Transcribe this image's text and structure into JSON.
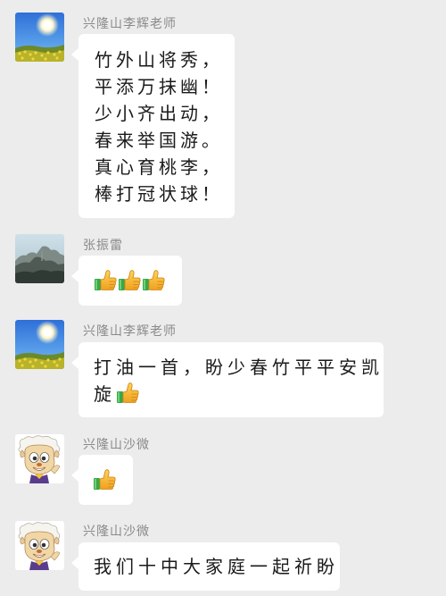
{
  "messages": [
    {
      "sender": "兴隆山李辉老师",
      "avatar": "sky-sunflower-avatar",
      "lines": [
        "竹外山将秀，",
        "平添万抹幽！",
        "少小齐出动，",
        "春来举国游。",
        "真心育桃李，",
        "棒打冠状球！"
      ]
    },
    {
      "sender": "张振雷",
      "avatar": "mountain-avatar",
      "emoji": "thumbs-up-icon"
    },
    {
      "sender": "兴隆山李辉老师",
      "avatar": "sky-sunflower-avatar",
      "text_line1": "打油一首，盼少春竹平平安凯",
      "text_line2": "旋"
    },
    {
      "sender": "兴隆山沙微",
      "avatar": "cartoon-sheep-avatar",
      "emoji": "thumbs-up-icon"
    },
    {
      "sender": "兴隆山沙微",
      "avatar": "cartoon-sheep-avatar",
      "text": "我们十中大家庭一起祈盼"
    }
  ],
  "colors": {
    "background": "#ececec",
    "bubble": "#ffffff",
    "sender_name": "#8a8a8a",
    "thumb_yellow": "#f5b82e",
    "cuff_green": "#3aa845"
  }
}
